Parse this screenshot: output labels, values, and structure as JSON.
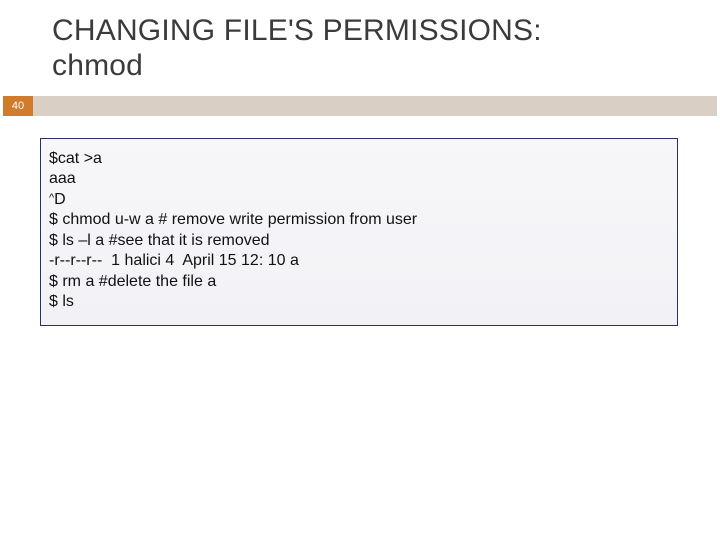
{
  "title_line1": "CHANGING FILE'S PERMISSIONS:",
  "title_line2": "chmod",
  "page_number": "40",
  "code": {
    "l1": "$cat >a",
    "l2": "aaa",
    "l3_caret": "^",
    "l3_rest": "D",
    "l4": "$ chmod u-w a # remove write permission from user",
    "l5": "$ ls –l a #see that it is removed",
    "l6": "-r--r--r--  1 halici 4  April 15 12: 10 a",
    "l7": "$ rm a #delete the file a",
    "l8": "$ ls"
  }
}
